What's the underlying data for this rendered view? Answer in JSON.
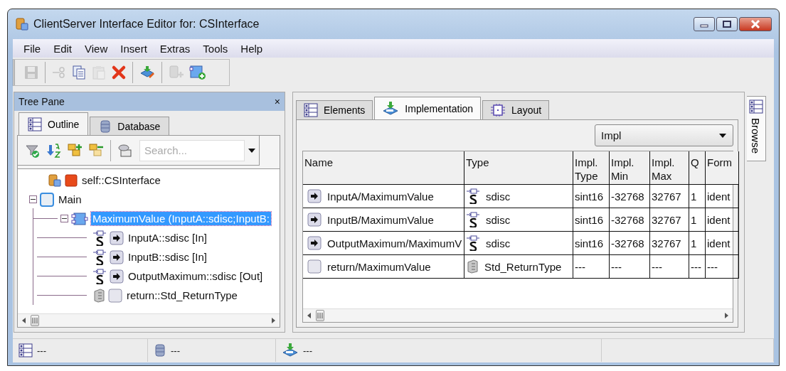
{
  "window": {
    "title": "ClientServer Interface Editor for: CSInterface"
  },
  "menu": [
    "File",
    "Edit",
    "View",
    "Insert",
    "Extras",
    "Tools",
    "Help"
  ],
  "toolbar": [
    {
      "kind": "save",
      "disabled": true
    },
    {
      "kind": "separator"
    },
    {
      "kind": "cut",
      "disabled": true
    },
    {
      "kind": "copy",
      "disabled": false
    },
    {
      "kind": "paste",
      "disabled": true
    },
    {
      "kind": "delete",
      "disabled": false
    },
    {
      "kind": "separator"
    },
    {
      "kind": "sync",
      "disabled": false
    },
    {
      "kind": "separator"
    },
    {
      "kind": "adddb",
      "disabled": true
    },
    {
      "kind": "addnode",
      "disabled": false
    }
  ],
  "tree_pane": {
    "title": "Tree Pane",
    "close": "×",
    "tabs": [
      {
        "label": "Outline",
        "kind": "outline",
        "selected": true
      },
      {
        "label": "Database",
        "kind": "database",
        "selected": false
      }
    ],
    "search": {
      "placeholder": "Search..."
    },
    "tree": [
      {
        "label": "self::CSInterface",
        "kind": "interface",
        "selected": false
      },
      {
        "label": "Main",
        "kind": "main",
        "selected": false,
        "expanded": true,
        "children": [
          {
            "label": "MaximumValue (InputA::sdisc;InputB:",
            "kind": "function",
            "selected": true,
            "expanded": true,
            "children": [
              {
                "label": "InputA::sdisc [In]",
                "kind": "input",
                "selected": false
              },
              {
                "label": "InputB::sdisc [In]",
                "kind": "input",
                "selected": false
              },
              {
                "label": "OutputMaximum::sdisc [Out]",
                "kind": "input",
                "selected": false
              },
              {
                "label": "return::Std_ReturnType",
                "kind": "return",
                "selected": false
              }
            ]
          }
        ]
      }
    ]
  },
  "main_pane": {
    "tabs": [
      {
        "label": "Elements",
        "kind": "elements",
        "selected": false
      },
      {
        "label": "Implementation",
        "kind": "impl",
        "selected": true
      },
      {
        "label": "Layout",
        "kind": "layout",
        "selected": false
      }
    ],
    "dropdown": {
      "value": "Impl"
    },
    "side_tab": "Browse",
    "table": {
      "columns": [
        "Name",
        "Type",
        "Impl. Type",
        "Impl. Min",
        "Impl. Max",
        "Q",
        "Form"
      ],
      "rows": [
        {
          "kind": "input",
          "cells": [
            "InputA/MaximumValue",
            "sdisc",
            "sint16",
            "-32768",
            "32767",
            "1",
            "ident"
          ]
        },
        {
          "kind": "input",
          "cells": [
            "InputB/MaximumValue",
            "sdisc",
            "sint16",
            "-32768",
            "32767",
            "1",
            "ident"
          ]
        },
        {
          "kind": "input",
          "cells": [
            "OutputMaximum/MaximumV",
            "sdisc",
            "sint16",
            "-32768",
            "32767",
            "1",
            "ident"
          ]
        },
        {
          "kind": "return",
          "cells": [
            "return/MaximumValue",
            "Std_ReturnType",
            "---",
            "---",
            "---",
            "---",
            "---"
          ]
        }
      ]
    }
  },
  "status_bar": [
    {
      "kind": "outline",
      "text": "---"
    },
    {
      "kind": "database",
      "text": "---"
    },
    {
      "kind": "impl",
      "text": "---"
    }
  ]
}
